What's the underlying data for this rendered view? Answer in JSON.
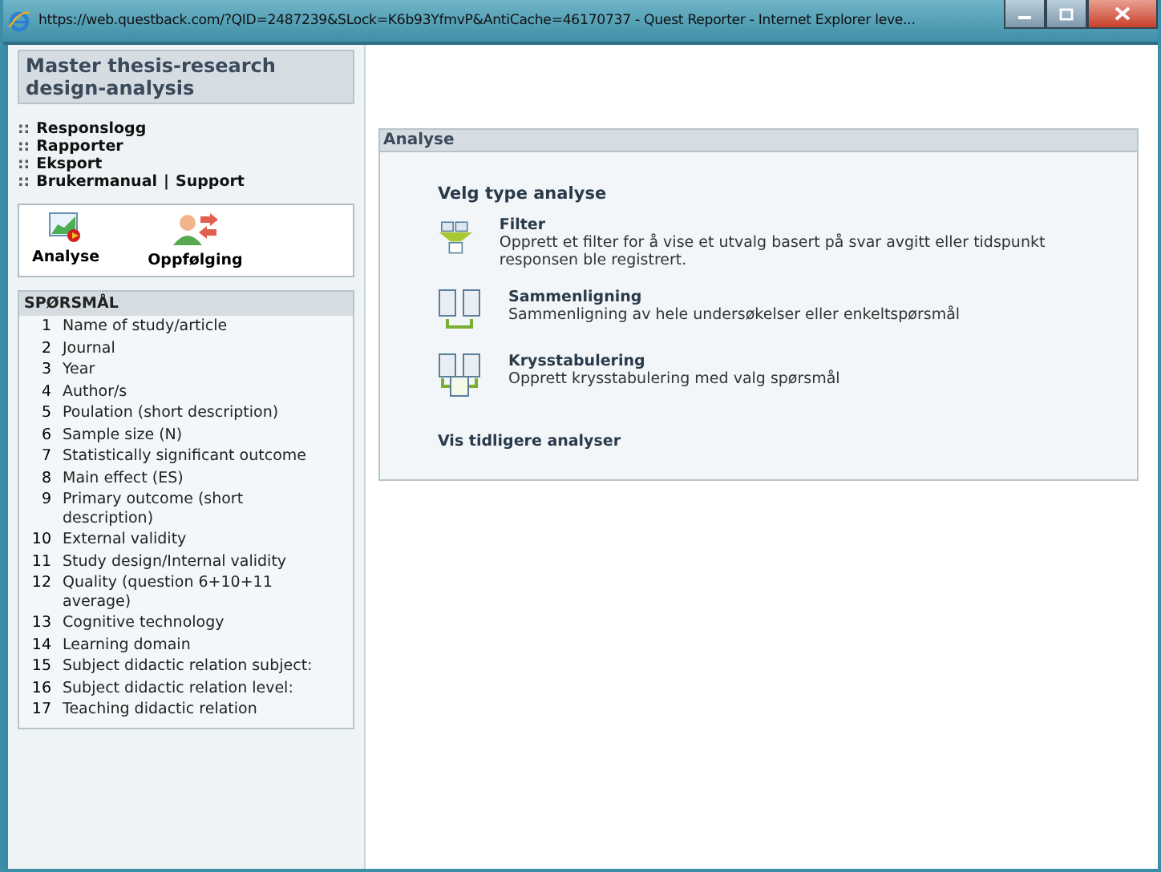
{
  "window": {
    "title": "https://web.questback.com/?QID=2487239&SLock=K6b93YfmvP&AntiCache=46170737 - Quest Reporter - Internet Explorer leve..."
  },
  "sidebar": {
    "title": "Master thesis-research design-analysis",
    "links": [
      {
        "bullet": "::",
        "label": "Responslogg"
      },
      {
        "bullet": "::",
        "label": "Rapporter"
      },
      {
        "bullet": "::",
        "label": "Eksport"
      },
      {
        "bullet": "::",
        "label": "Brukermanual",
        "separator": "|",
        "extra": "Support"
      }
    ],
    "tools": [
      {
        "kind": "analysis",
        "label": "Analyse"
      },
      {
        "kind": "followup",
        "label": "Oppfølging"
      }
    ],
    "questions_heading": "SPØRSMÅL",
    "questions": [
      {
        "number": "1",
        "text": "Name of study/article"
      },
      {
        "number": "2",
        "text": "Journal"
      },
      {
        "number": "3",
        "text": "Year"
      },
      {
        "number": "4",
        "text": "Author/s"
      },
      {
        "number": "5",
        "text": "Poulation (short description)"
      },
      {
        "number": "6",
        "text": "Sample size (N)"
      },
      {
        "number": "7",
        "text": "Statistically significant outcome"
      },
      {
        "number": "8",
        "text": "Main effect (ES)"
      },
      {
        "number": "9",
        "text": "Primary outcome (short description)"
      },
      {
        "number": "10",
        "text": "External validity"
      },
      {
        "number": "11",
        "text": "Study design/Internal validity"
      },
      {
        "number": "12",
        "text": "Quality (question 6+10+11 average)"
      },
      {
        "number": "13",
        "text": "Cognitive technology"
      },
      {
        "number": "14",
        "text": "Learning domain"
      },
      {
        "number": "15",
        "text": "Subject didactic relation subject:"
      },
      {
        "number": "16",
        "text": "Subject didactic relation level:"
      },
      {
        "number": "17",
        "text": "Teaching didactic relation"
      }
    ]
  },
  "panel": {
    "title": "Analyse",
    "heading": "Velg type analyse",
    "options": [
      {
        "kind": "filter",
        "title": "Filter",
        "description": "Opprett et filter for å vise et utvalg basert på svar avgitt eller tidspunkt responsen ble registrert."
      },
      {
        "kind": "compare",
        "title": "Sammenligning",
        "description": "Sammenligning av hele undersøkelser eller enkeltspørsmål"
      },
      {
        "kind": "crosstab",
        "title": "Krysstabulering",
        "description": "Opprett krysstabulering med valg spørsmål"
      }
    ],
    "footer_link": "Vis tidligere analyser"
  }
}
